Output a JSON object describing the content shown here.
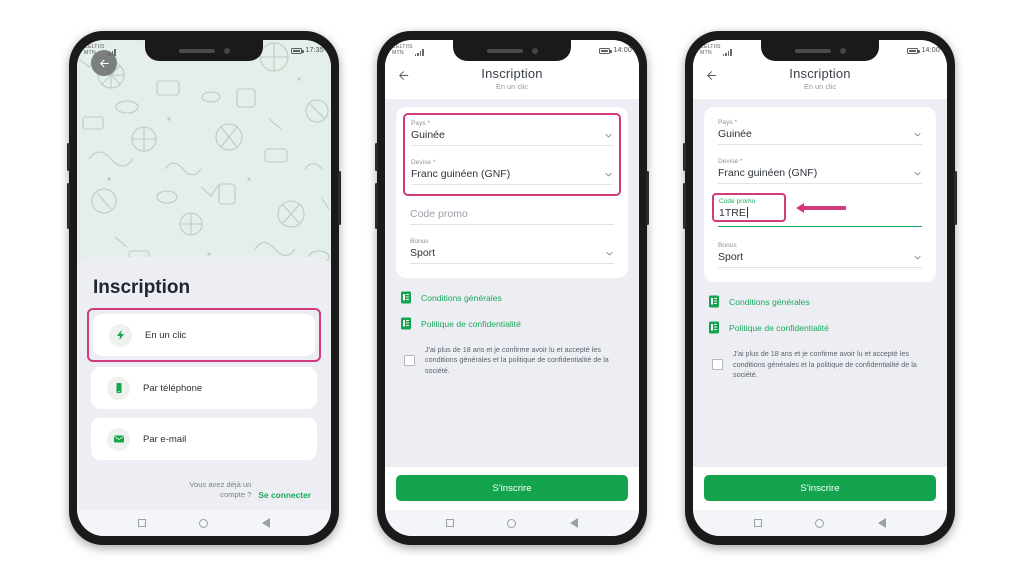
{
  "status_bar": {
    "carrier_line1": "CELTIIS",
    "carrier_line2": "MTN",
    "time_phone1": "17:35",
    "time_phone2": "14:00",
    "time_phone3": "14:00"
  },
  "colors": {
    "brand_green": "#14a44d",
    "link_green": "#1aa85a",
    "highlight_pink": "#d13b7c",
    "screen_bg": "#eceef4",
    "hero_bg": "#e4efe9"
  },
  "phone1": {
    "back_icon": "arrow-left-icon",
    "title": "Inscription",
    "options": [
      {
        "label": "En un clic",
        "icon": "lightning-bolt-icon",
        "highlighted": true
      },
      {
        "label": "Par téléphone",
        "icon": "mobile-phone-icon",
        "highlighted": false
      },
      {
        "label": "Par e-mail",
        "icon": "envelope-icon",
        "highlighted": false
      }
    ],
    "login_prompt": "Vous avez déjà un compte ?",
    "login_link": "Se connecter"
  },
  "phone2": {
    "header": {
      "title": "Inscription",
      "subtitle": "En un clic",
      "back_icon": "arrow-left-icon"
    },
    "fields": [
      {
        "label": "Pays *",
        "value": "Guinée",
        "type": "select",
        "placeholder": ""
      },
      {
        "label": "Devise *",
        "value": "Franc guinéen (GNF)",
        "type": "select",
        "placeholder": ""
      },
      {
        "label": "",
        "value": "",
        "type": "text",
        "placeholder": "Code promo"
      },
      {
        "label": "Bonus",
        "value": "Sport",
        "type": "select",
        "placeholder": ""
      }
    ],
    "links": [
      {
        "label": "Conditions générales",
        "icon": "document-icon"
      },
      {
        "label": "Politique de confidentialité",
        "icon": "document-icon"
      }
    ],
    "consent": "J'ai plus de 18 ans et je confirme avoir lu et accepté les conditions générales et la politique de confidentialité de la société.",
    "consent_checked": false,
    "submit": "S'inscrire"
  },
  "phone3": {
    "header": {
      "title": "Inscription",
      "subtitle": "En un clic",
      "back_icon": "arrow-left-icon"
    },
    "fields": [
      {
        "label": "Pays *",
        "value": "Guinée",
        "type": "select",
        "placeholder": ""
      },
      {
        "label": "Devise *",
        "value": "Franc guinéen (GNF)",
        "type": "select",
        "placeholder": ""
      },
      {
        "label": "Code promo",
        "value": "1TRE",
        "type": "text",
        "placeholder": "Code promo",
        "focused": true
      },
      {
        "label": "Bonus",
        "value": "Sport",
        "type": "select",
        "placeholder": ""
      }
    ],
    "links": [
      {
        "label": "Conditions générales",
        "icon": "document-icon"
      },
      {
        "label": "Politique de confidentialité",
        "icon": "document-icon"
      }
    ],
    "consent": "J'ai plus de 18 ans et je confirme avoir lu et accepté les conditions générales et la politique de confidentialité de la société.",
    "consent_checked": false,
    "submit": "S'inscrire",
    "annotation_arrow": "arrow-pointing-left-to-promo-field"
  },
  "navbar": {
    "recent": "square-button",
    "home": "circle-button",
    "back": "triangle-back-button"
  }
}
